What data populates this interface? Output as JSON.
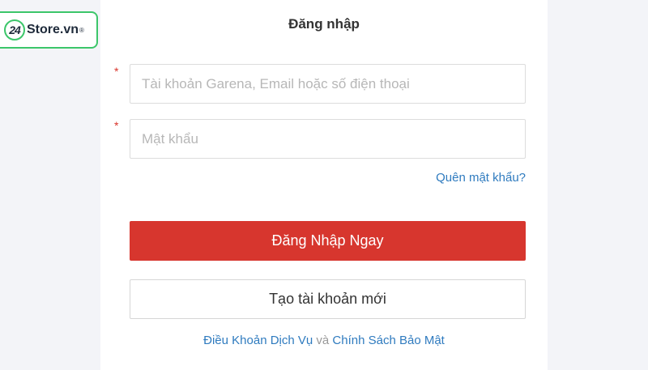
{
  "watermark": {
    "badge": "24",
    "text": "Store.vn",
    "registered": "®",
    "accent_color": "#3cc66a"
  },
  "login": {
    "title": "Đăng nhập",
    "required_mark": "*",
    "account_field": {
      "value": "",
      "placeholder": "Tài khoản Garena, Email hoặc số điện thoại"
    },
    "password_field": {
      "value": "",
      "placeholder": "Mật khẩu"
    },
    "forgot_password": "Quên mật khẩu?",
    "login_button": "Đăng Nhập Ngay",
    "create_account_button": "Tạo tài khoản mới",
    "footer": {
      "terms": "Điều Khoản Dịch Vụ",
      "conjunction": "và",
      "privacy": "Chính Sách Bảo Mật"
    }
  },
  "colors": {
    "primary_button": "#d7362e",
    "link": "#2f7bbf",
    "page_background": "#f3f4f8"
  }
}
